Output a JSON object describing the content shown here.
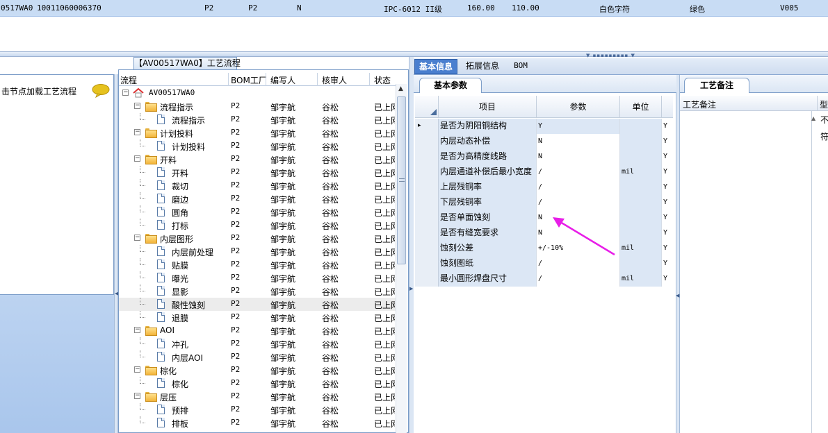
{
  "top_row": {
    "cells": [
      "0517WA0",
      "10011060006370",
      "P2",
      "P2",
      "N",
      "IPC-6012 II级",
      "160.00",
      "110.00",
      "白色字符",
      "绿色",
      "V005"
    ]
  },
  "left_panel": {
    "hint": "击节点加载工艺流程",
    "icon": "speech-bubble-icon"
  },
  "tree_panel": {
    "title": "【AV00517WA0】工艺流程",
    "headers": [
      "流程",
      "BOM工厂",
      "编写人",
      "核审人",
      "状态"
    ],
    "rows": [
      {
        "name": "AV00517WA0",
        "level": 0,
        "icon": "house",
        "exp": "−",
        "bom": "",
        "author": "",
        "reviewer": "",
        "status": ""
      },
      {
        "name": "流程指示",
        "level": 1,
        "icon": "folder",
        "exp": "−",
        "bom": "P2",
        "author": "邹宇航",
        "reviewer": "谷松",
        "status": "已上网"
      },
      {
        "name": "流程指示",
        "level": 2,
        "icon": "doc",
        "exp": "",
        "bom": "P2",
        "author": "邹宇航",
        "reviewer": "谷松",
        "status": "已上网"
      },
      {
        "name": "计划投料",
        "level": 1,
        "icon": "folder",
        "exp": "−",
        "bom": "P2",
        "author": "邹宇航",
        "reviewer": "谷松",
        "status": "已上网"
      },
      {
        "name": "计划投料",
        "level": 2,
        "icon": "doc",
        "exp": "",
        "bom": "P2",
        "author": "邹宇航",
        "reviewer": "谷松",
        "status": "已上网"
      },
      {
        "name": "开料",
        "level": 1,
        "icon": "folder",
        "exp": "−",
        "bom": "P2",
        "author": "邹宇航",
        "reviewer": "谷松",
        "status": "已上网"
      },
      {
        "name": "开料",
        "level": 2,
        "icon": "doc",
        "exp": "",
        "bom": "P2",
        "author": "邹宇航",
        "reviewer": "谷松",
        "status": "已上网"
      },
      {
        "name": "裁切",
        "level": 2,
        "icon": "doc",
        "exp": "",
        "bom": "P2",
        "author": "邹宇航",
        "reviewer": "谷松",
        "status": "已上网"
      },
      {
        "name": "磨边",
        "level": 2,
        "icon": "doc",
        "exp": "",
        "bom": "P2",
        "author": "邹宇航",
        "reviewer": "谷松",
        "status": "已上网"
      },
      {
        "name": "圆角",
        "level": 2,
        "icon": "doc",
        "exp": "",
        "bom": "P2",
        "author": "邹宇航",
        "reviewer": "谷松",
        "status": "已上网"
      },
      {
        "name": "打标",
        "level": 2,
        "icon": "doc",
        "exp": "",
        "bom": "P2",
        "author": "邹宇航",
        "reviewer": "谷松",
        "status": "已上网"
      },
      {
        "name": "内层图形",
        "level": 1,
        "icon": "folder",
        "exp": "−",
        "bom": "P2",
        "author": "邹宇航",
        "reviewer": "谷松",
        "status": "已上网"
      },
      {
        "name": "内层前处理",
        "level": 2,
        "icon": "doc",
        "exp": "",
        "bom": "P2",
        "author": "邹宇航",
        "reviewer": "谷松",
        "status": "已上网"
      },
      {
        "name": "贴膜",
        "level": 2,
        "icon": "doc",
        "exp": "",
        "bom": "P2",
        "author": "邹宇航",
        "reviewer": "谷松",
        "status": "已上网"
      },
      {
        "name": "曝光",
        "level": 2,
        "icon": "doc",
        "exp": "",
        "bom": "P2",
        "author": "邹宇航",
        "reviewer": "谷松",
        "status": "已上网"
      },
      {
        "name": "显影",
        "level": 2,
        "icon": "doc",
        "exp": "",
        "bom": "P2",
        "author": "邹宇航",
        "reviewer": "谷松",
        "status": "已上网"
      },
      {
        "name": "酸性蚀刻",
        "level": 2,
        "icon": "doc",
        "exp": "",
        "bom": "P2",
        "author": "邹宇航",
        "reviewer": "谷松",
        "status": "已上网",
        "selected": true
      },
      {
        "name": "退膜",
        "level": 2,
        "icon": "doc",
        "exp": "",
        "bom": "P2",
        "author": "邹宇航",
        "reviewer": "谷松",
        "status": "已上网"
      },
      {
        "name": "AOI",
        "level": 1,
        "icon": "folder",
        "exp": "−",
        "bom": "P2",
        "author": "邹宇航",
        "reviewer": "谷松",
        "status": "已上网"
      },
      {
        "name": "冲孔",
        "level": 2,
        "icon": "doc",
        "exp": "",
        "bom": "P2",
        "author": "邹宇航",
        "reviewer": "谷松",
        "status": "已上网"
      },
      {
        "name": "内层AOI",
        "level": 2,
        "icon": "doc",
        "exp": "",
        "bom": "P2",
        "author": "邹宇航",
        "reviewer": "谷松",
        "status": "已上网"
      },
      {
        "name": "棕化",
        "level": 1,
        "icon": "folder",
        "exp": "−",
        "bom": "P2",
        "author": "邹宇航",
        "reviewer": "谷松",
        "status": "已上网"
      },
      {
        "name": "棕化",
        "level": 2,
        "icon": "doc",
        "exp": "",
        "bom": "P2",
        "author": "邹宇航",
        "reviewer": "谷松",
        "status": "已上网"
      },
      {
        "name": "层压",
        "level": 1,
        "icon": "folder",
        "exp": "−",
        "bom": "P2",
        "author": "邹宇航",
        "reviewer": "谷松",
        "status": "已上网"
      },
      {
        "name": "预排",
        "level": 2,
        "icon": "doc",
        "exp": "",
        "bom": "P2",
        "author": "邹宇航",
        "reviewer": "谷松",
        "status": "已上网"
      },
      {
        "name": "排板",
        "level": 2,
        "icon": "doc",
        "exp": "",
        "bom": "P2",
        "author": "邹宇航",
        "reviewer": "谷松",
        "status": "已上网"
      }
    ]
  },
  "tabs": {
    "basic_info": "基本信息",
    "extended_info": "拓展信息",
    "bom": "BOM"
  },
  "basic_params": {
    "tab_label": "基本参数",
    "headers": {
      "item": "项目",
      "param": "参数",
      "unit": "单位"
    },
    "rows": [
      {
        "item": "是否为阴阳铜结构",
        "param": "Y",
        "unit": "",
        "flag": "Y",
        "current": true
      },
      {
        "item": "内层动态补偿",
        "param": "N",
        "unit": "",
        "flag": "Y"
      },
      {
        "item": "是否为高精度线路",
        "param": "N",
        "unit": "",
        "flag": "Y"
      },
      {
        "item": "内层通道补偿后最小宽度",
        "param": "/",
        "unit": "mil",
        "flag": "Y"
      },
      {
        "item": "上层残铜率",
        "param": "/",
        "unit": "",
        "flag": "Y"
      },
      {
        "item": "下层残铜率",
        "param": "/",
        "unit": "",
        "flag": "Y"
      },
      {
        "item": "是否单面蚀刻",
        "param": "N",
        "unit": "",
        "flag": "Y"
      },
      {
        "item": "是否有缝宽要求",
        "param": "N",
        "unit": "",
        "flag": "Y"
      },
      {
        "item": "蚀刻公差",
        "param": "+/-10%",
        "unit": "mil",
        "flag": "Y"
      },
      {
        "item": "蚀刻图纸",
        "param": "/",
        "unit": "",
        "flag": "Y"
      },
      {
        "item": "最小圆形焊盘尺寸",
        "param": "/",
        "unit": "mil",
        "flag": "Y"
      }
    ]
  },
  "notes": {
    "tab_label": "工艺备注",
    "header": "工艺备注",
    "header_extra": "型",
    "extra_1": "不",
    "extra_2": "符"
  },
  "colors": {
    "annotation_arrow": "#e81ee8",
    "active_tab": "#4a7fcf",
    "selected_row": "#c8dcf4"
  }
}
